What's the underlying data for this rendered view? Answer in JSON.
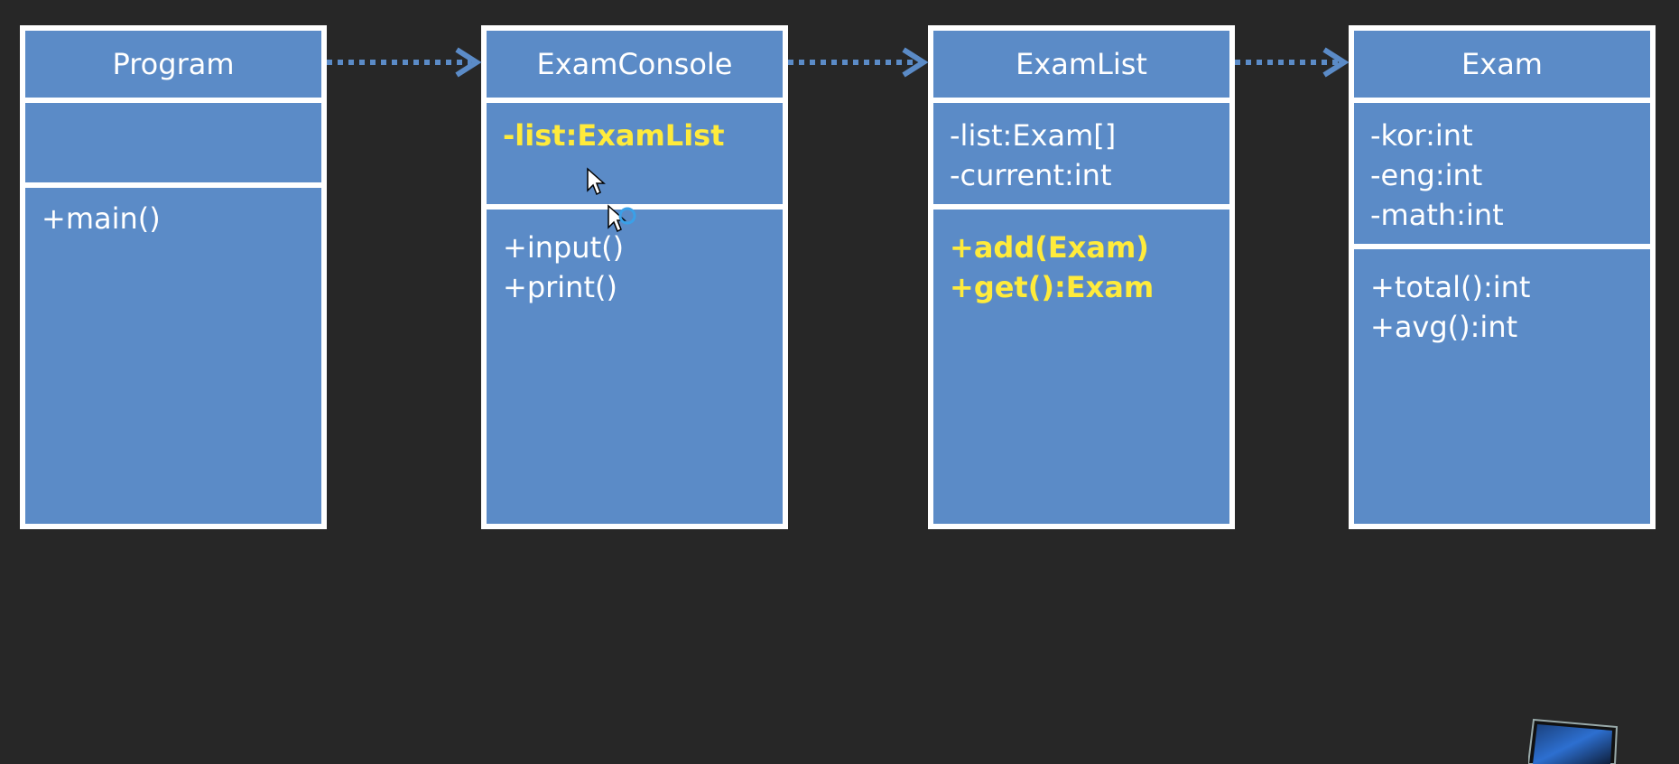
{
  "diagram": {
    "classes": [
      {
        "id": "program",
        "name": "Program",
        "attributes": [],
        "operations": [
          {
            "text": "+main()",
            "highlight": false
          }
        ]
      },
      {
        "id": "examconsole",
        "name": "ExamConsole",
        "attributes": [
          {
            "text": "-list:ExamList",
            "highlight": true
          }
        ],
        "operations": [
          {
            "text": "+input()",
            "highlight": false
          },
          {
            "text": "+print()",
            "highlight": false
          }
        ]
      },
      {
        "id": "examlist",
        "name": "ExamList",
        "attributes": [
          {
            "text": "-list:Exam[]",
            "highlight": false
          },
          {
            "text": "-current:int",
            "highlight": false
          }
        ],
        "operations": [
          {
            "text": "+add(Exam)",
            "highlight": true
          },
          {
            "text": "+get():Exam",
            "highlight": true
          }
        ]
      },
      {
        "id": "exam",
        "name": "Exam",
        "attributes": [
          {
            "text": "-kor:int",
            "highlight": false
          },
          {
            "text": "-eng:int",
            "highlight": false
          },
          {
            "text": "-math:int",
            "highlight": false
          }
        ],
        "operations": [
          {
            "text": "+total():int",
            "highlight": false
          },
          {
            "text": "+avg():int",
            "highlight": false
          }
        ]
      }
    ],
    "dependencies": [
      {
        "from": "program",
        "to": "examconsole",
        "style": "dotted-open-arrow"
      },
      {
        "from": "examconsole",
        "to": "examlist",
        "style": "dotted-open-arrow"
      },
      {
        "from": "examlist",
        "to": "exam",
        "style": "dotted-open-arrow"
      }
    ]
  },
  "colors": {
    "background": "#272727",
    "box_fill": "#5b8bc7",
    "box_border": "#ffffff",
    "text": "#ffffff",
    "highlight_text": "#ffeb3b",
    "arrow": "#5b8bc7"
  }
}
